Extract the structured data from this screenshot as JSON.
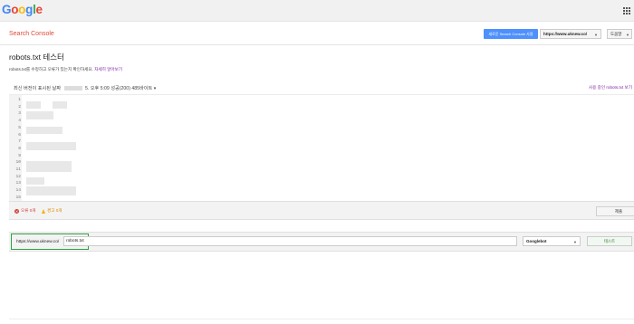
{
  "topbar": {
    "logo_letters": [
      {
        "ch": "G",
        "color": "#4285f4"
      },
      {
        "ch": "o",
        "color": "#ea4335"
      },
      {
        "ch": "o",
        "color": "#fbbc05"
      },
      {
        "ch": "g",
        "color": "#4285f4"
      },
      {
        "ch": "l",
        "color": "#34a853"
      },
      {
        "ch": "e",
        "color": "#ea4335"
      }
    ]
  },
  "header": {
    "product_title": "Search Console",
    "new_sc_button": "새로운 Search Console 사용",
    "site_selector": "https://www.uknew.co/",
    "help_button": "도움말"
  },
  "page": {
    "title": "robots.txt 테스터",
    "description": "robots.txt를 수정하고 오류가 있는지 확인하세요.",
    "learn_more": "자세히 알아보기"
  },
  "version": {
    "prefix": "최신 버전이 표시된 날짜",
    "suffix": "5. 오후 5:09 성공(200) 485바이트 ▾",
    "live_link": "사용 중인 robots.txt 보기"
  },
  "editor": {
    "line_numbers": [
      "1",
      "2",
      "3",
      "4",
      "5",
      "6",
      "7",
      "8",
      "9",
      "10",
      "11",
      "12",
      "13",
      "14",
      "15"
    ]
  },
  "status": {
    "errors": "오류 0개",
    "warnings": "경고 0개",
    "submit": "제출"
  },
  "tester": {
    "url_prefix": "https://www.uknew.co/",
    "url_value": "robots.txt",
    "bot_select": "Googlebot",
    "test_button": "테스트"
  },
  "colors": {
    "accent_blue": "#4d90fe",
    "sc_red": "#dd4b39",
    "error_red": "#d23f31",
    "warning_yellow": "#f4b400",
    "highlight_green": "#2ea043"
  }
}
